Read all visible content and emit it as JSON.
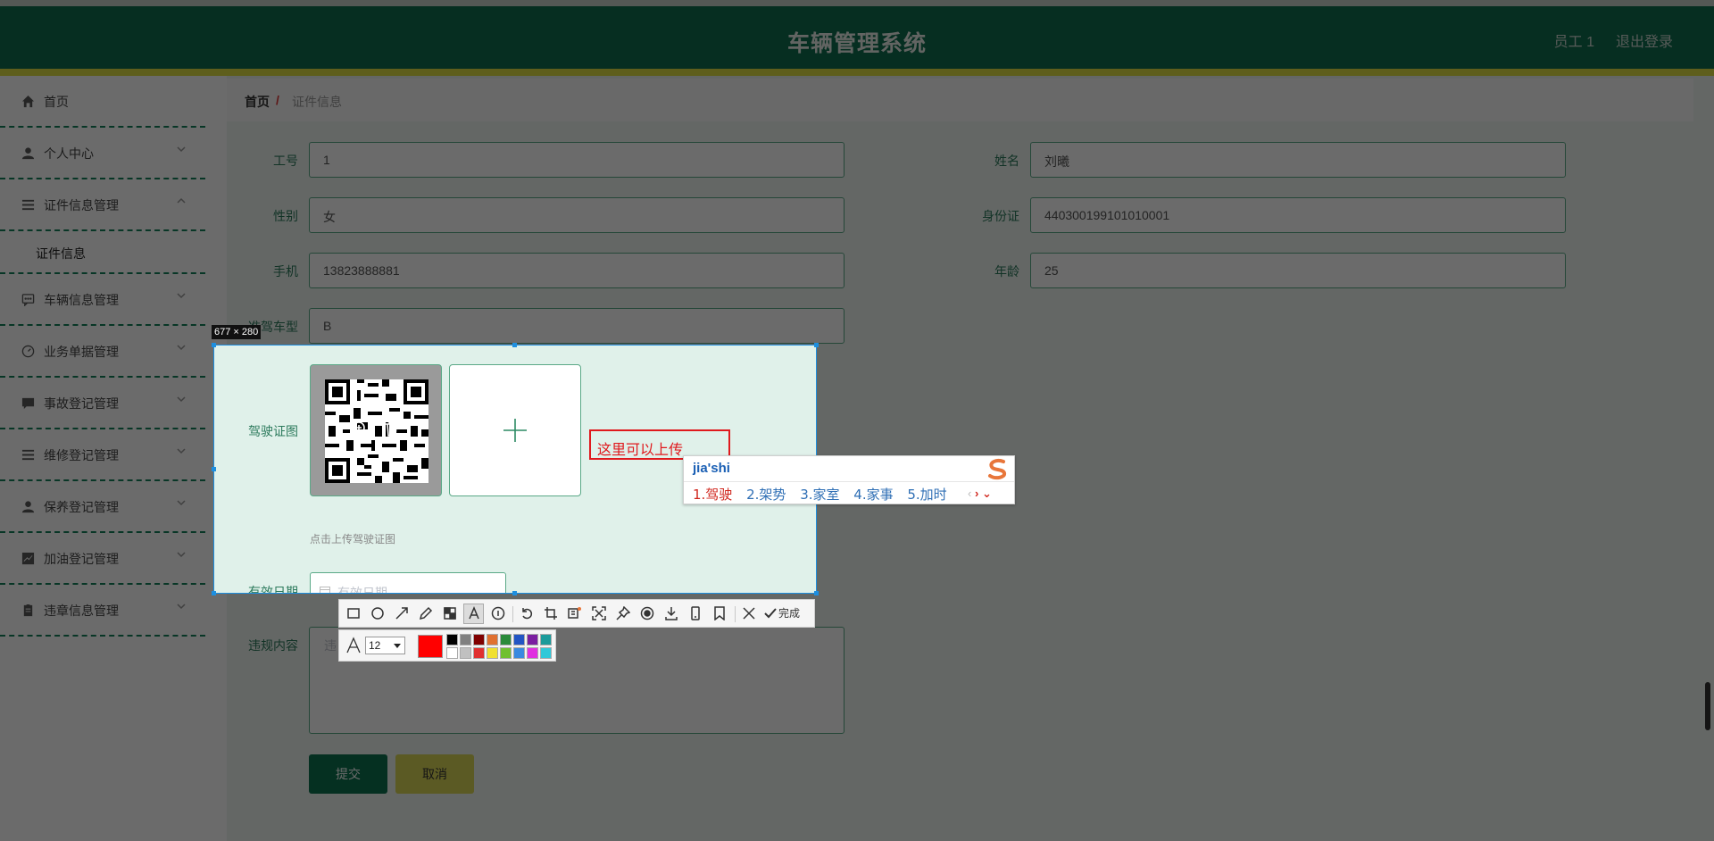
{
  "header": {
    "title": "车辆管理系统",
    "user": "员工 1",
    "logout": "退出登录"
  },
  "sidebar": {
    "items": [
      {
        "label": "首页",
        "icon": "home-icon"
      },
      {
        "label": "个人中心",
        "icon": "user-icon"
      },
      {
        "label": "证件信息管理",
        "icon": "list-icon"
      },
      {
        "label": "证件信息",
        "icon": ""
      },
      {
        "label": "车辆信息管理",
        "icon": "chat-icon"
      },
      {
        "label": "业务单据管理",
        "icon": "gauge-icon"
      },
      {
        "label": "事故登记管理",
        "icon": "message-icon"
      },
      {
        "label": "维修登记管理",
        "icon": "list-icon"
      },
      {
        "label": "保养登记管理",
        "icon": "user-icon"
      },
      {
        "label": "加油登记管理",
        "icon": "chart-icon"
      },
      {
        "label": "违章信息管理",
        "icon": "clipboard-icon"
      }
    ]
  },
  "breadcrumb": {
    "home": "首页",
    "separator": "/",
    "current": "证件信息"
  },
  "form": {
    "gonghao": {
      "label": "工号",
      "value": "1"
    },
    "xingming": {
      "label": "姓名",
      "value": "刘曦"
    },
    "xingbie": {
      "label": "性别",
      "value": "女"
    },
    "shenfenzheng": {
      "label": "身份证",
      "value": "440300199101010001"
    },
    "shouji": {
      "label": "手机",
      "value": "13823888881"
    },
    "nianling": {
      "label": "年龄",
      "value": "25"
    },
    "chexing": {
      "label": "准驾车型",
      "value": "B"
    },
    "jiashizhengtu": {
      "label": "驾驶证图",
      "hint": "点击上传驾驶证图"
    },
    "youxiaoriqi": {
      "label": "有效日期",
      "placeholder": "有效日期"
    },
    "weigui": {
      "label": "违规内容",
      "placeholder": "违"
    },
    "submit": "提交",
    "cancel": "取消"
  },
  "capture": {
    "size_label": "677 × 280",
    "annotation_text": "这里可以上传",
    "done_label": "完成",
    "font_size": "12",
    "current_color": "#ff0000",
    "palette_top": [
      "#000000",
      "#808080",
      "#800000",
      "#e07030",
      "#2a8a3a",
      "#2255c4",
      "#7a1fa0",
      "#1a9a9a"
    ],
    "palette_bottom": [
      "#ffffff",
      "#c0c0c0",
      "#e03030",
      "#f0e030",
      "#70c030",
      "#3a8ae0",
      "#e030e0",
      "#30c8d8"
    ]
  },
  "ime": {
    "pinyin": "jia'shi",
    "candidates": [
      "1.驾驶",
      "2.架势",
      "3.家室",
      "4.家事",
      "5.加时"
    ]
  }
}
